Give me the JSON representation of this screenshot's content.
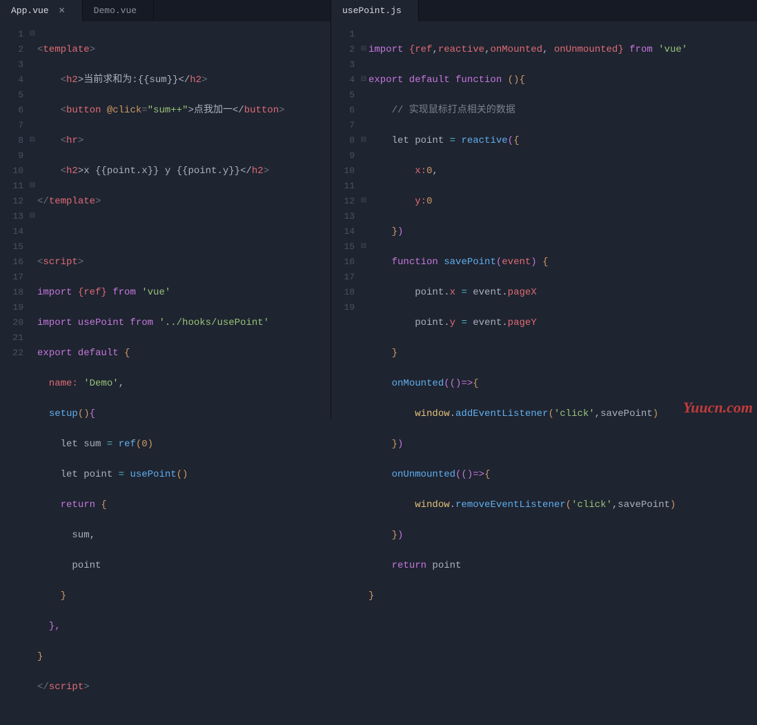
{
  "left": {
    "tabs": [
      {
        "label": "App.vue",
        "active": true,
        "closeable": true
      },
      {
        "label": "Demo.vue",
        "active": false,
        "closeable": false
      }
    ],
    "lines": [
      "1",
      "2",
      "3",
      "4",
      "5",
      "6",
      "7",
      "8",
      "9",
      "10",
      "11",
      "12",
      "13",
      "14",
      "15",
      "16",
      "17",
      "18",
      "19",
      "20",
      "21",
      "22"
    ],
    "fold": {
      "1": "⊟",
      "8": "⊟",
      "11": "⊟",
      "13": "⊟"
    },
    "code": {
      "l1": "<template>",
      "l2a": "    <",
      "l2b": "h2",
      "l2c": ">当前求和为:{{sum}}</",
      "l2d": "h2",
      "l2e": ">",
      "l3a": "    <",
      "l3b": "button",
      "l3c": " @click",
      "l3d": "=",
      "l3e": "\"sum++\"",
      "l3f": ">点我加一</",
      "l3g": "button",
      "l3h": ">",
      "l4a": "    <",
      "l4b": "hr",
      "l4c": ">",
      "l5a": "    <",
      "l5b": "h2",
      "l5c": ">x {{point.x}} y {{point.y}}</",
      "l5d": "h2",
      "l5e": ">",
      "l6": "</template>",
      "l7": "",
      "l8a": "<",
      "l8b": "script",
      "l8c": ">",
      "l9a": "import ",
      "l9b": "{ref} ",
      "l9c": "from ",
      "l9d": "'vue'",
      "l10a": "import usePoint from ",
      "l10b": "'../hooks/usePoint'",
      "l11a": "export default ",
      "l11b": "{",
      "l12a": "  name: ",
      "l12b": "'Demo'",
      "l12c": ",",
      "l13a": "  ",
      "l13b": "setup",
      "l13c": "()",
      "l13d": "{",
      "l14a": "    let sum ",
      "l14b": "= ",
      "l14c": "ref",
      "l14d": "(",
      "l14e": "0",
      "l14f": ")",
      "l15a": "    let point ",
      "l15b": "= ",
      "l15c": "usePoint",
      "l15d": "()",
      "l16a": "    ",
      "l16b": "return ",
      "l16c": "{",
      "l17": "      sum,",
      "l18": "      point",
      "l19": "    }",
      "l20": "  },",
      "l21": "}",
      "l22a": "</",
      "l22b": "script",
      "l22c": ">"
    }
  },
  "right": {
    "tabs": [
      {
        "label": "usePoint.js",
        "active": true
      }
    ],
    "lines": [
      "1",
      "2",
      "3",
      "4",
      "5",
      "6",
      "7",
      "8",
      "9",
      "10",
      "11",
      "12",
      "13",
      "14",
      "15",
      "16",
      "17",
      "18",
      "19"
    ],
    "fold": {
      "2": "⊟",
      "4": "⊟",
      "8": "⊟",
      "12": "⊟",
      "15": "⊟"
    },
    "code": {
      "l1a": "import ",
      "l1b": "{",
      "l1c": "ref",
      "l1d": ",",
      "l1e": "reactive",
      "l1f": ",",
      "l1g": "onMounted",
      "l1h": ", ",
      "l1i": "onUnmounted",
      "l1j": "} ",
      "l1k": "from ",
      "l1l": "'vue'",
      "l2a": "export default function ",
      "l2b": "()",
      "l2c": "{",
      "l3": "    // 实现鼠标打点相关的数据",
      "l4a": "    let point ",
      "l4b": "= ",
      "l4c": "reactive",
      "l4d": "(",
      "l4e": "{",
      "l5a": "        x:",
      "l5b": "0",
      "l5c": ",",
      "l6a": "        y:",
      "l6b": "0",
      "l7a": "    ",
      "l7b": "}",
      "l7c": ")",
      "l8a": "    ",
      "l8b": "function ",
      "l8c": "savePoint",
      "l8d": "(",
      "l8e": "event",
      "l8f": ") ",
      "l8g": "{",
      "l9a": "        point",
      "l9b": ".",
      "l9c": "x ",
      "l9d": "= ",
      "l9e": "event",
      "l9f": ".",
      "l9g": "pageX",
      "l10a": "        point",
      "l10b": ".",
      "l10c": "y ",
      "l10d": "= ",
      "l10e": "event",
      "l10f": ".",
      "l10g": "pageY",
      "l11": "    }",
      "l12a": "    ",
      "l12b": "onMounted",
      "l12c": "((",
      "l12d": ")=>",
      "l12e": "{",
      "l13a": "        window",
      "l13b": ".",
      "l13c": "addEventListener",
      "l13d": "(",
      "l13e": "'click'",
      "l13f": ",savePoint",
      "l13g": ")",
      "l14a": "    ",
      "l14b": "}",
      "l14c": ")",
      "l15a": "    ",
      "l15b": "onUnmounted",
      "l15c": "((",
      "l15d": ")=>",
      "l15e": "{",
      "l16a": "        window",
      "l16b": ".",
      "l16c": "removeEventListener",
      "l16d": "(",
      "l16e": "'click'",
      "l16f": ",savePoint",
      "l16g": ")",
      "l17a": "    ",
      "l17b": "}",
      "l17c": ")",
      "l18a": "    ",
      "l18b": "return ",
      "l18c": "point",
      "l19": "}"
    }
  },
  "watermark": "Yuucn.com"
}
